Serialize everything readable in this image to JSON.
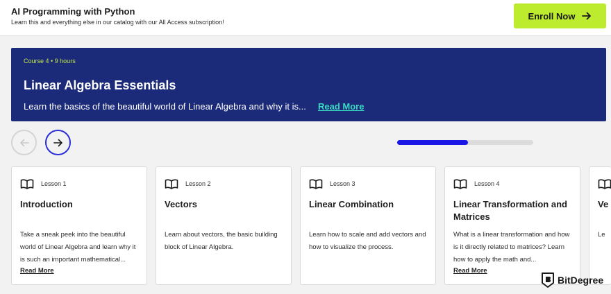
{
  "header": {
    "title": "AI Programming with Python",
    "subtitle": "Learn this and everything else in our catalog with our All Access subscription!",
    "enroll_label": "Enroll Now",
    "enroll_icon": "arrow-right-icon"
  },
  "banner": {
    "meta": "Course 4 • 9 hours",
    "title": "Linear Algebra Essentials",
    "description": "Learn the basics of the beautiful world of Linear Algebra and why it is...",
    "read_more": "Read More"
  },
  "carousel": {
    "prev_icon": "arrow-left-icon",
    "next_icon": "arrow-right-icon",
    "progress_fraction": 0.52
  },
  "lessons": [
    {
      "lesson": "Lesson 1",
      "title": "Introduction",
      "description": "Take a sneak peek into the beautiful world of Linear Algebra and learn why it is such an important mathematical...",
      "read_more": "Read More"
    },
    {
      "lesson": "Lesson 2",
      "title": "Vectors",
      "description": "Learn about vectors, the basic building block of Linear Algebra."
    },
    {
      "lesson": "Lesson 3",
      "title": "Linear Combination",
      "description": "Learn how to scale and add vectors and how to visualize the process."
    },
    {
      "lesson": "Lesson 4",
      "title": "Linear Transformation and Matrices",
      "description": "What is a linear transformation and how is it directly related to matrices? Learn how to apply the math and...",
      "read_more": "Read More"
    },
    {
      "lesson": "",
      "title": "Ve",
      "description": "Le"
    }
  ],
  "watermark": {
    "text": "BitDegree"
  },
  "colors": {
    "accent_green": "#bdeb2d",
    "banner_navy": "#1c2a7a",
    "link_teal": "#3ad9c1",
    "progress_blue": "#1a16e6"
  }
}
